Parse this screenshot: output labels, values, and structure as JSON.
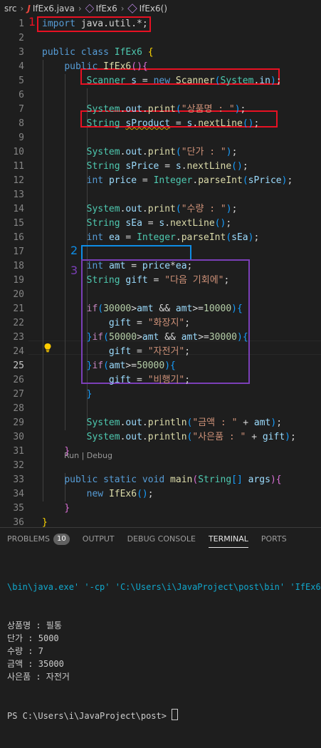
{
  "breadcrumb": {
    "folder": "src",
    "file": "IfEx6.java",
    "class": "IfEx6",
    "method": "IfEx6()"
  },
  "annotations": {
    "a1": "1",
    "a2": "2",
    "a3": "3"
  },
  "codelens": "Run | Debug",
  "active_line": "25",
  "colors": {
    "red_box": "#e81123",
    "blue_box": "#0e8de6",
    "purple_box": "#7b3fb8",
    "keyword": "#569cd6",
    "string": "#ce9178",
    "type": "#4ec9b0"
  },
  "lines": [
    {
      "n": "1",
      "tokens": [
        [
          "kw",
          "import"
        ],
        [
          "pun",
          " java.util.*;"
        ]
      ]
    },
    {
      "n": "2",
      "tokens": []
    },
    {
      "n": "3",
      "tokens": [
        [
          "kw",
          "public"
        ],
        [
          "pun",
          " "
        ],
        [
          "kw",
          "class"
        ],
        [
          "pun",
          " "
        ],
        [
          "ty",
          "IfEx6"
        ],
        [
          "pun",
          " "
        ],
        [
          "br1",
          "{"
        ]
      ]
    },
    {
      "n": "4",
      "tokens": [
        [
          "pun",
          "    "
        ],
        [
          "kw",
          "public"
        ],
        [
          "pun",
          " "
        ],
        [
          "fn",
          "IfEx6"
        ],
        [
          "br2",
          "()"
        ],
        [
          "br2",
          "{"
        ]
      ]
    },
    {
      "n": "5",
      "tokens": [
        [
          "pun",
          "        "
        ],
        [
          "ty",
          "Scanner"
        ],
        [
          "pun",
          " "
        ],
        [
          "var",
          "s"
        ],
        [
          "pun",
          " = "
        ],
        [
          "kw",
          "new"
        ],
        [
          "pun",
          " "
        ],
        [
          "fn",
          "Scanner"
        ],
        [
          "br3",
          "("
        ],
        [
          "ty",
          "System"
        ],
        [
          "pun",
          "."
        ],
        [
          "var",
          "in"
        ],
        [
          "br3",
          ")"
        ],
        [
          "pun",
          ";"
        ]
      ]
    },
    {
      "n": "6",
      "tokens": []
    },
    {
      "n": "7",
      "tokens": [
        [
          "pun",
          "        "
        ],
        [
          "ty",
          "System"
        ],
        [
          "pun",
          "."
        ],
        [
          "var",
          "out"
        ],
        [
          "pun",
          "."
        ],
        [
          "fn",
          "print"
        ],
        [
          "br3",
          "("
        ],
        [
          "str",
          "\"상품명 : \""
        ],
        [
          "br3",
          ")"
        ],
        [
          "pun",
          ";"
        ]
      ]
    },
    {
      "n": "8",
      "tokens": [
        [
          "pun",
          "        "
        ],
        [
          "ty",
          "String"
        ],
        [
          "pun",
          " "
        ],
        [
          "var squig",
          "sProduct"
        ],
        [
          "pun",
          " = "
        ],
        [
          "var",
          "s"
        ],
        [
          "pun",
          "."
        ],
        [
          "fn",
          "nextLine"
        ],
        [
          "br3",
          "()"
        ],
        [
          "pun",
          ";"
        ]
      ]
    },
    {
      "n": "9",
      "tokens": []
    },
    {
      "n": "10",
      "tokens": [
        [
          "pun",
          "        "
        ],
        [
          "ty",
          "System"
        ],
        [
          "pun",
          "."
        ],
        [
          "var",
          "out"
        ],
        [
          "pun",
          "."
        ],
        [
          "fn",
          "print"
        ],
        [
          "br3",
          "("
        ],
        [
          "str",
          "\"단가 : \""
        ],
        [
          "br3",
          ")"
        ],
        [
          "pun",
          ";"
        ]
      ]
    },
    {
      "n": "11",
      "tokens": [
        [
          "pun",
          "        "
        ],
        [
          "ty",
          "String"
        ],
        [
          "pun",
          " "
        ],
        [
          "var",
          "sPrice"
        ],
        [
          "pun",
          " = "
        ],
        [
          "var",
          "s"
        ],
        [
          "pun",
          "."
        ],
        [
          "fn",
          "nextLine"
        ],
        [
          "br3",
          "()"
        ],
        [
          "pun",
          ";"
        ]
      ]
    },
    {
      "n": "12",
      "tokens": [
        [
          "pun",
          "        "
        ],
        [
          "kw",
          "int"
        ],
        [
          "pun",
          " "
        ],
        [
          "var",
          "price"
        ],
        [
          "pun",
          " = "
        ],
        [
          "ty",
          "Integer"
        ],
        [
          "pun",
          "."
        ],
        [
          "fn",
          "parseInt"
        ],
        [
          "br3",
          "("
        ],
        [
          "var",
          "sPrice"
        ],
        [
          "br3",
          ")"
        ],
        [
          "pun",
          ";"
        ]
      ]
    },
    {
      "n": "13",
      "tokens": []
    },
    {
      "n": "14",
      "tokens": [
        [
          "pun",
          "        "
        ],
        [
          "ty",
          "System"
        ],
        [
          "pun",
          "."
        ],
        [
          "var",
          "out"
        ],
        [
          "pun",
          "."
        ],
        [
          "fn",
          "print"
        ],
        [
          "br3",
          "("
        ],
        [
          "str",
          "\"수량 : \""
        ],
        [
          "br3",
          ")"
        ],
        [
          "pun",
          ";"
        ]
      ]
    },
    {
      "n": "15",
      "tokens": [
        [
          "pun",
          "        "
        ],
        [
          "ty",
          "String"
        ],
        [
          "pun",
          " "
        ],
        [
          "var",
          "sEa"
        ],
        [
          "pun",
          " = "
        ],
        [
          "var",
          "s"
        ],
        [
          "pun",
          "."
        ],
        [
          "fn",
          "nextLine"
        ],
        [
          "br3",
          "()"
        ],
        [
          "pun",
          ";"
        ]
      ]
    },
    {
      "n": "16",
      "tokens": [
        [
          "pun",
          "        "
        ],
        [
          "kw",
          "int"
        ],
        [
          "pun",
          " "
        ],
        [
          "var",
          "ea"
        ],
        [
          "pun",
          " = "
        ],
        [
          "ty",
          "Integer"
        ],
        [
          "pun",
          "."
        ],
        [
          "fn",
          "parseInt"
        ],
        [
          "br3",
          "("
        ],
        [
          "var",
          "sEa"
        ],
        [
          "br3",
          ")"
        ],
        [
          "pun",
          ";"
        ]
      ]
    },
    {
      "n": "17",
      "tokens": []
    },
    {
      "n": "18",
      "tokens": [
        [
          "pun",
          "        "
        ],
        [
          "kw",
          "int"
        ],
        [
          "pun",
          " "
        ],
        [
          "var",
          "amt"
        ],
        [
          "pun",
          " = "
        ],
        [
          "var",
          "price"
        ],
        [
          "pun",
          "*"
        ],
        [
          "var",
          "ea"
        ],
        [
          "pun",
          ";"
        ]
      ]
    },
    {
      "n": "19",
      "tokens": [
        [
          "pun",
          "        "
        ],
        [
          "ty",
          "String"
        ],
        [
          "pun",
          " "
        ],
        [
          "var",
          "gift"
        ],
        [
          "pun",
          " = "
        ],
        [
          "str",
          "\"다음 기회에\""
        ],
        [
          "pun",
          ";"
        ]
      ]
    },
    {
      "n": "20",
      "tokens": []
    },
    {
      "n": "21",
      "tokens": [
        [
          "pun",
          "        "
        ],
        [
          "ctrl",
          "if"
        ],
        [
          "br3",
          "("
        ],
        [
          "num",
          "30000"
        ],
        [
          "pun",
          ">"
        ],
        [
          "var",
          "amt"
        ],
        [
          "pun",
          " && "
        ],
        [
          "var",
          "amt"
        ],
        [
          "pun",
          ">="
        ],
        [
          "num",
          "10000"
        ],
        [
          "br3",
          ")"
        ],
        [
          "br3",
          "{"
        ]
      ]
    },
    {
      "n": "22",
      "tokens": [
        [
          "pun",
          "            "
        ],
        [
          "var",
          "gift"
        ],
        [
          "pun",
          " = "
        ],
        [
          "str",
          "\"화장지\""
        ],
        [
          "pun",
          ";"
        ]
      ]
    },
    {
      "n": "23",
      "tokens": [
        [
          "pun",
          "        "
        ],
        [
          "br3",
          "}"
        ],
        [
          "ctrl",
          "if"
        ],
        [
          "br3",
          "("
        ],
        [
          "num",
          "50000"
        ],
        [
          "pun",
          ">"
        ],
        [
          "var",
          "amt"
        ],
        [
          "pun",
          " && "
        ],
        [
          "var",
          "amt"
        ],
        [
          "pun",
          ">="
        ],
        [
          "num",
          "30000"
        ],
        [
          "br3",
          ")"
        ],
        [
          "br3",
          "{"
        ]
      ]
    },
    {
      "n": "24",
      "tokens": [
        [
          "pun",
          "            "
        ],
        [
          "var",
          "gift"
        ],
        [
          "pun",
          " = "
        ],
        [
          "str",
          "\"자전거\""
        ],
        [
          "pun",
          ";"
        ]
      ]
    },
    {
      "n": "25",
      "tokens": [
        [
          "pun",
          "        "
        ],
        [
          "br3",
          "}"
        ],
        [
          "ctrl",
          "if"
        ],
        [
          "br3",
          "("
        ],
        [
          "var",
          "amt"
        ],
        [
          "pun",
          ">="
        ],
        [
          "num",
          "50000"
        ],
        [
          "br3",
          ")"
        ],
        [
          "br3",
          "{"
        ]
      ]
    },
    {
      "n": "26",
      "tokens": [
        [
          "pun",
          "            "
        ],
        [
          "var",
          "gift"
        ],
        [
          "pun",
          " = "
        ],
        [
          "str",
          "\"비행기\""
        ],
        [
          "pun",
          ";"
        ]
      ]
    },
    {
      "n": "27",
      "tokens": [
        [
          "pun",
          "        "
        ],
        [
          "br3",
          "}"
        ]
      ]
    },
    {
      "n": "28",
      "tokens": []
    },
    {
      "n": "29",
      "tokens": [
        [
          "pun",
          "        "
        ],
        [
          "ty",
          "System"
        ],
        [
          "pun",
          "."
        ],
        [
          "var",
          "out"
        ],
        [
          "pun",
          "."
        ],
        [
          "fn",
          "println"
        ],
        [
          "br3",
          "("
        ],
        [
          "str",
          "\"금액 : \""
        ],
        [
          "pun",
          " + "
        ],
        [
          "var",
          "amt"
        ],
        [
          "br3",
          ")"
        ],
        [
          "pun",
          ";"
        ]
      ]
    },
    {
      "n": "30",
      "tokens": [
        [
          "pun",
          "        "
        ],
        [
          "ty",
          "System"
        ],
        [
          "pun",
          "."
        ],
        [
          "var",
          "out"
        ],
        [
          "pun",
          "."
        ],
        [
          "fn",
          "println"
        ],
        [
          "br3",
          "("
        ],
        [
          "str",
          "\"사은품 : \""
        ],
        [
          "pun",
          " + "
        ],
        [
          "var",
          "gift"
        ],
        [
          "br3",
          ")"
        ],
        [
          "pun",
          ";"
        ]
      ]
    },
    {
      "n": "31",
      "tokens": [
        [
          "pun",
          "    "
        ],
        [
          "br2",
          "}"
        ]
      ]
    },
    {
      "n": "32",
      "tokens": []
    },
    {
      "n": "33",
      "tokens": [
        [
          "pun",
          "    "
        ],
        [
          "kw",
          "public"
        ],
        [
          "pun",
          " "
        ],
        [
          "kw",
          "static"
        ],
        [
          "pun",
          " "
        ],
        [
          "kw",
          "void"
        ],
        [
          "pun",
          " "
        ],
        [
          "fn",
          "main"
        ],
        [
          "br2",
          "("
        ],
        [
          "ty",
          "String"
        ],
        [
          "br3",
          "[]"
        ],
        [
          "pun",
          " "
        ],
        [
          "var",
          "args"
        ],
        [
          "br2",
          ")"
        ],
        [
          "br2",
          "{"
        ]
      ]
    },
    {
      "n": "34",
      "tokens": [
        [
          "pun",
          "        "
        ],
        [
          "kw",
          "new"
        ],
        [
          "pun",
          " "
        ],
        [
          "fn",
          "IfEx6"
        ],
        [
          "br3",
          "()"
        ],
        [
          "pun",
          ";"
        ]
      ]
    },
    {
      "n": "35",
      "tokens": [
        [
          "pun",
          "    "
        ],
        [
          "br2",
          "}"
        ]
      ]
    },
    {
      "n": "36",
      "tokens": [
        [
          "br1",
          "}"
        ]
      ]
    }
  ],
  "panel": {
    "tabs": [
      {
        "label": "PROBLEMS",
        "badge": "10",
        "active": false
      },
      {
        "label": "OUTPUT",
        "active": false
      },
      {
        "label": "DEBUG CONSOLE",
        "active": false
      },
      {
        "label": "TERMINAL",
        "active": true
      },
      {
        "label": "PORTS",
        "active": false
      }
    ],
    "terminal_cmd": "\\bin\\java.exe' '-cp' 'C:\\Users\\i\\JavaProject\\post\\bin' 'IfEx6'",
    "terminal_output": [
      "상품명 : 필통",
      "단가 : 5000",
      "수량 : 7",
      "금액 : 35000",
      "사은품 : 자전거"
    ],
    "prompt": "PS C:\\Users\\i\\JavaProject\\post> "
  }
}
